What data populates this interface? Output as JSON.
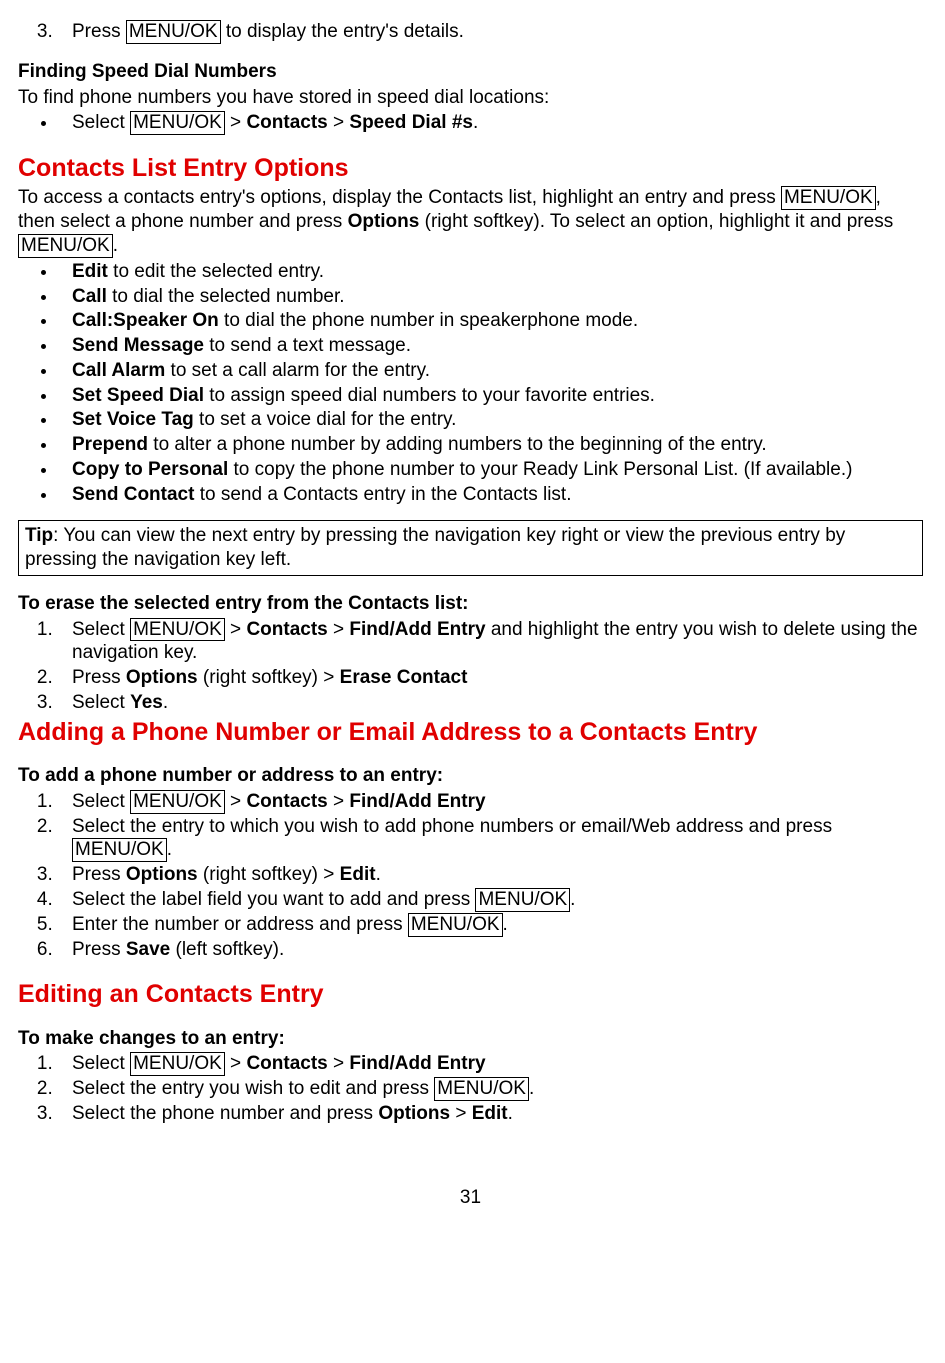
{
  "key_menuok": "MENU/OK",
  "step3_a": "Press ",
  "step3_b": " to display the entry's details.",
  "finding_head": "Finding Speed Dial Numbers",
  "finding_intro": "To find phone numbers you have stored in speed dial locations:",
  "finding_item_a": "Select ",
  "finding_item_b": " > ",
  "contacts_word": "Contacts",
  "finding_item_c": " > ",
  "speeddial_word": "Speed Dial #s",
  "finding_item_d": ".",
  "h2_options": "Contacts List Entry Options",
  "options_intro_a": "To access a contacts entry's options, display the Contacts list, highlight an entry and press ",
  "options_intro_b": ", then select a phone number and press ",
  "options_word": "Options",
  "options_intro_c": " (right softkey). To select an option, highlight it and press ",
  "options_intro_d": ".",
  "opt_edit_a": "Edit",
  "opt_edit_b": " to edit the selected entry.",
  "opt_call_a": "Call",
  "opt_call_b": " to dial the selected number.",
  "opt_spk_a": "Call:Speaker On",
  "opt_spk_b": " to dial the phone number in speakerphone mode.",
  "opt_msg_a": "Send Message",
  "opt_msg_b": " to send a text message.",
  "opt_alarm_a": "Call Alarm",
  "opt_alarm_b": " to set a call alarm for the entry.",
  "opt_sd_a": "Set Speed Dial",
  "opt_sd_b": " to assign speed dial numbers to your favorite entries.",
  "opt_vt_a": "Set Voice Tag",
  "opt_vt_b": " to set a voice dial for the entry.",
  "opt_pre_a": "Prepend",
  "opt_pre_b": " to alter a phone number by adding numbers to the beginning of the entry.",
  "opt_copy_a": "Copy to Personal",
  "opt_copy_b": " to copy the phone number to your Ready Link Personal List. (If available.)",
  "opt_send_a": "Send Contact",
  "opt_send_b": " to send a Contacts entry in the Contacts list.",
  "tip_a": "Tip",
  "tip_b": ": You can view the next entry by pressing the navigation key right or view the previous entry by pressing the navigation key left.",
  "erase_head": "To erase the selected entry from the Contacts list:",
  "erase1_a": "Select ",
  "findadd_word": "Find/Add Entry",
  "erase1_b": " and highlight the entry you wish to delete using the navigation key.",
  "erase2_a": "Press ",
  "erase2_b": " (right softkey) > ",
  "erasecontact_word": "Erase Contact",
  "erase3_a": "Select ",
  "yes_word": "Yes",
  "erase3_b": ".",
  "h2_adding": "Adding a Phone Number or Email Address to a Contacts Entry",
  "add_head": "To add a phone number or address to an entry:",
  "add1_a": "Select ",
  "add2": "Select the entry to which you wish to add phone numbers or email/Web address and press ",
  "add2_b": ".",
  "add3_a": "Press ",
  "add3_b": " (right softkey) > ",
  "edit_word": "Edit",
  "add3_c": ".",
  "add4_a": "Select the label field you want to add and press ",
  "add4_b": ".",
  "add5_a": "Enter the number or address and press ",
  "add5_b": ".",
  "add6_a": "Press ",
  "save_word": "Save",
  "add6_b": " (left softkey).",
  "h2_editing": "Editing an Contacts Entry",
  "edit_head": "To make changes to an entry:",
  "edit1_a": "Select ",
  "edit2_a": "Select the entry you wish to edit and press ",
  "edit2_b": ".",
  "edit3_a": "Select the phone number and press ",
  "edit3_b": " > ",
  "edit3_c": ".",
  "pagenum": "31"
}
